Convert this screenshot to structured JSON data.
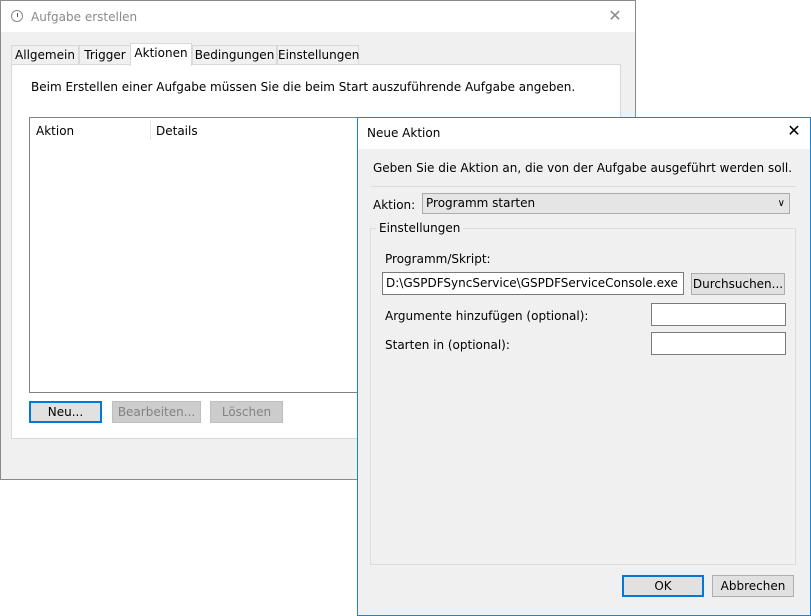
{
  "main_window": {
    "title": "Aufgabe erstellen",
    "tabs": [
      "Allgemein",
      "Trigger",
      "Aktionen",
      "Bedingungen",
      "Einstellungen"
    ],
    "active_tab": "Aktionen",
    "description": "Beim Erstellen einer Aufgabe müssen Sie die beim Start auszuführende Aufgabe angeben.",
    "columns": [
      "Aktion",
      "Details"
    ],
    "buttons": {
      "new": "Neu...",
      "edit": "Bearbeiten...",
      "delete": "Löschen"
    },
    "close_glyph": "✕"
  },
  "dialog": {
    "title": "Neue Aktion",
    "close_glyph": "✕",
    "instruction": "Geben Sie die Aktion an, die von der Aufgabe ausgeführt werden soll.",
    "action_label": "Aktion:",
    "action_value": "Programm starten",
    "settings_group": "Einstellungen",
    "program_label": "Programm/Skript:",
    "program_value": "D:\\GSPDFSyncService\\GSPDFServiceConsole.exe",
    "browse_button": "Durchsuchen...",
    "arguments_label": "Argumente hinzufügen (optional):",
    "arguments_value": "",
    "start_in_label": "Starten in (optional):",
    "start_in_value": "",
    "ok_button": "OK",
    "cancel_button": "Abbrechen"
  },
  "colors": {
    "accent": "#0078d7",
    "window_bg": "#f0f0f0",
    "disabled_text": "#838383"
  },
  "icons": {
    "app": "clock-icon",
    "combo": "chevron-down-icon",
    "close": "close-icon"
  }
}
